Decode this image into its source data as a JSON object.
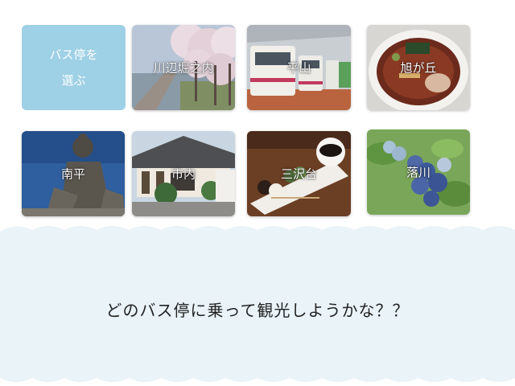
{
  "intro": {
    "line1": "バス停を",
    "line2": "選ぶ"
  },
  "stops": [
    {
      "label": "川辺堀之内",
      "photo": "cherry-blossom-path"
    },
    {
      "label": "平山",
      "photo": "train-depot"
    },
    {
      "label": "旭が丘",
      "photo": "ramen-bowl"
    },
    {
      "label": "南平",
      "photo": "buddha-statue"
    },
    {
      "label": "市内",
      "photo": "traditional-house"
    },
    {
      "label": "三沢台",
      "photo": "dango-and-coffee"
    },
    {
      "label": "落川",
      "photo": "blueberries"
    }
  ],
  "question": "どのバス停に乗って観光しようかな？？",
  "colors": {
    "intro_tile": "#9ed0e6",
    "panel": "#e9f3f8",
    "text": "#222222"
  }
}
